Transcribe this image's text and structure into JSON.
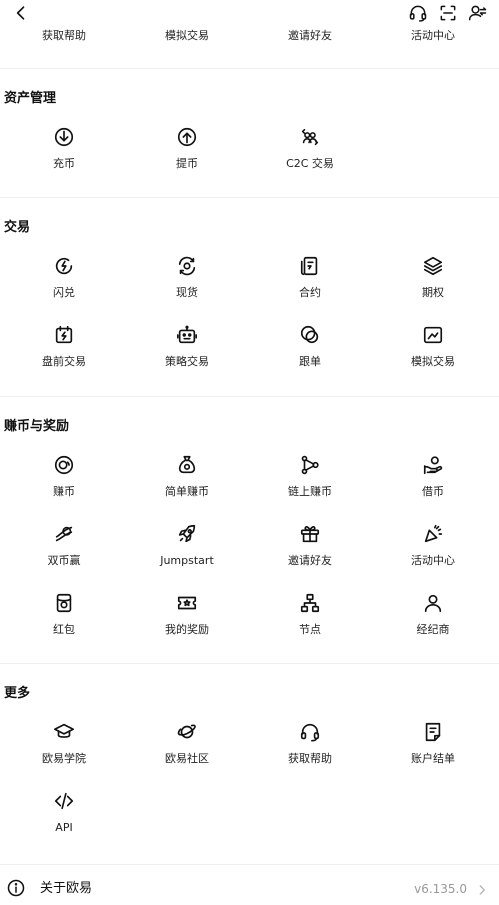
{
  "header": {
    "back_icon": "chevron-left-icon",
    "support_icon": "headset-icon",
    "scan_icon": "scan-icon",
    "profile_icon": "user-switch-icon"
  },
  "top_truncated_row": [
    "获取帮助",
    "模拟交易",
    "邀请好友",
    "活动中心"
  ],
  "sections": {
    "assets": {
      "title": "资产管理",
      "items": [
        {
          "label": "充币",
          "icon": "deposit-icon"
        },
        {
          "label": "提币",
          "icon": "withdraw-icon"
        },
        {
          "label": "C2C 交易",
          "icon": "c2c-icon"
        }
      ]
    },
    "trade": {
      "title": "交易",
      "items": [
        {
          "label": "闪兑",
          "icon": "flash-convert-icon"
        },
        {
          "label": "现货",
          "icon": "spot-icon"
        },
        {
          "label": "合约",
          "icon": "futures-icon"
        },
        {
          "label": "期权",
          "icon": "options-icon"
        },
        {
          "label": "盘前交易",
          "icon": "pre-market-icon"
        },
        {
          "label": "策略交易",
          "icon": "bot-icon"
        },
        {
          "label": "跟单",
          "icon": "copy-trade-icon"
        },
        {
          "label": "模拟交易",
          "icon": "demo-trade-icon"
        }
      ]
    },
    "earn": {
      "title": "赚币与奖励",
      "items": [
        {
          "label": "赚币",
          "icon": "earn-icon"
        },
        {
          "label": "简单赚币",
          "icon": "money-bag-icon"
        },
        {
          "label": "链上赚币",
          "icon": "onchain-icon"
        },
        {
          "label": "借币",
          "icon": "loan-icon"
        },
        {
          "label": "双币赢",
          "icon": "dual-currency-icon"
        },
        {
          "label": "Jumpstart",
          "icon": "rocket-icon"
        },
        {
          "label": "邀请好友",
          "icon": "gift-icon"
        },
        {
          "label": "活动中心",
          "icon": "party-icon"
        },
        {
          "label": "红包",
          "icon": "red-packet-icon"
        },
        {
          "label": "我的奖励",
          "icon": "ticket-icon"
        },
        {
          "label": "节点",
          "icon": "node-icon"
        },
        {
          "label": "经纪商",
          "icon": "broker-icon"
        }
      ]
    },
    "more": {
      "title": "更多",
      "items": [
        {
          "label": "欧易学院",
          "icon": "academy-icon"
        },
        {
          "label": "欧易社区",
          "icon": "planet-icon"
        },
        {
          "label": "获取帮助",
          "icon": "headset-icon"
        },
        {
          "label": "账户结单",
          "icon": "statement-icon"
        },
        {
          "label": "API",
          "icon": "code-icon"
        }
      ]
    }
  },
  "footer": {
    "about_label": "关于欧易",
    "version": "v6.135.0",
    "info_icon": "info-icon",
    "chevron_icon": "chevron-right-icon"
  }
}
